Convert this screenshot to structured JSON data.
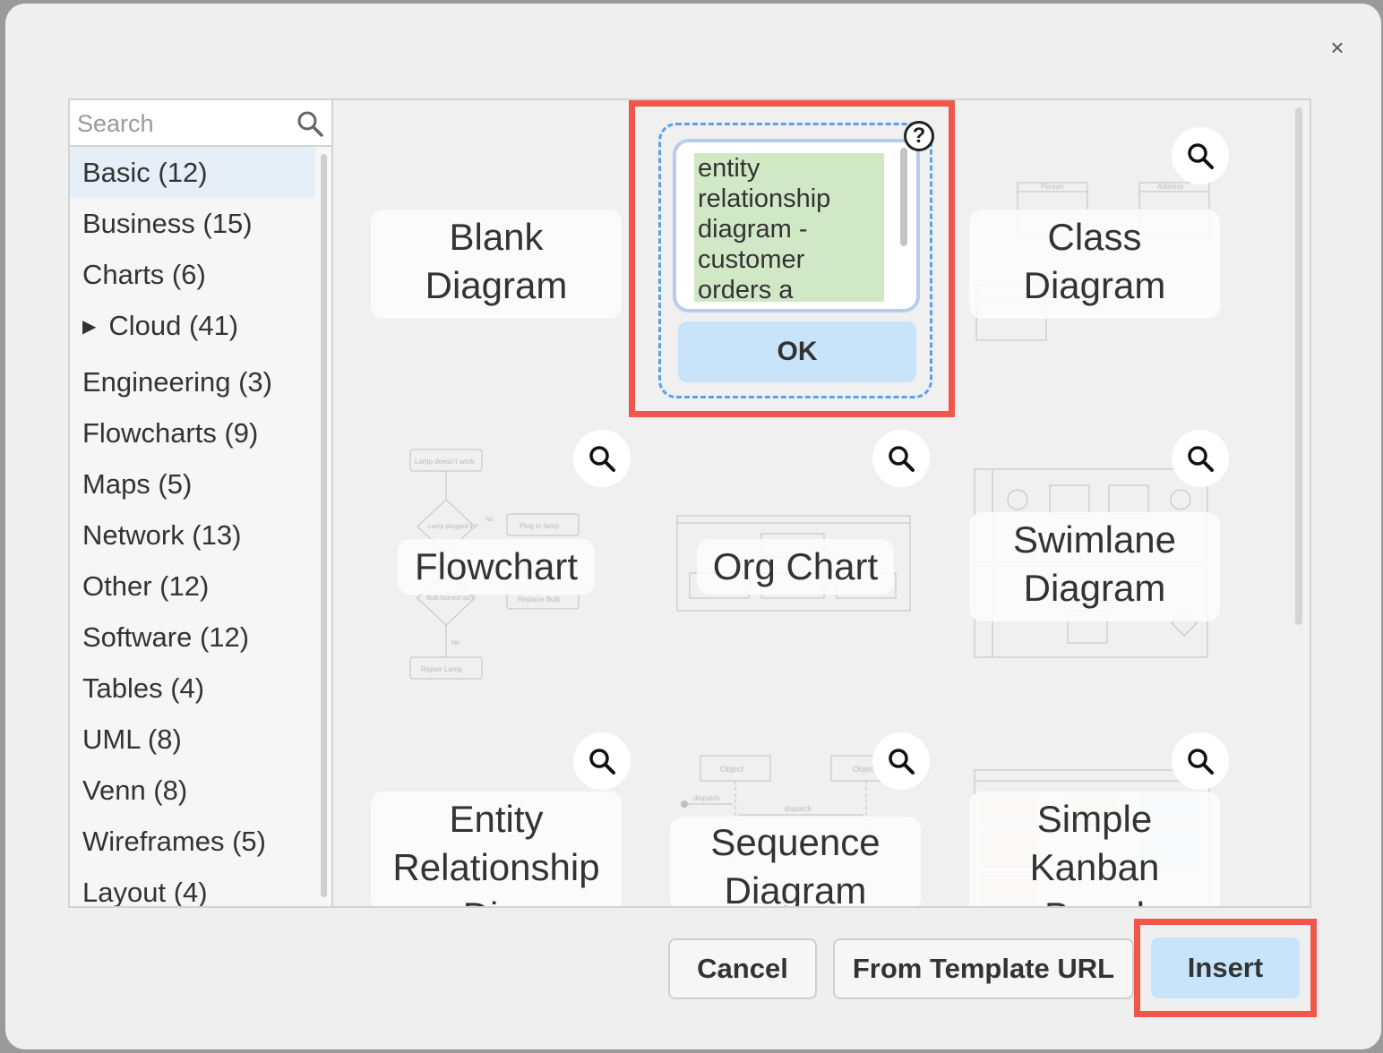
{
  "search": {
    "placeholder": "Search"
  },
  "categories": [
    {
      "label": "Basic (12)"
    },
    {
      "label": "Business (15)"
    },
    {
      "label": "Charts (6)"
    },
    {
      "label": "Cloud (41)",
      "arrow": "▶"
    },
    {
      "label": "Engineering (3)"
    },
    {
      "label": "Flowcharts (9)"
    },
    {
      "label": "Maps (5)"
    },
    {
      "label": "Network (13)"
    },
    {
      "label": "Other (12)"
    },
    {
      "label": "Software (12)"
    },
    {
      "label": "Tables (4)"
    },
    {
      "label": "UML (8)"
    },
    {
      "label": "Venn (8)"
    },
    {
      "label": "Wireframes (5)"
    },
    {
      "label": "Layout (4)"
    }
  ],
  "templates": {
    "blank": {
      "line1": "Blank",
      "line2": "Diagram"
    },
    "er_prompt": {
      "text": [
        "entity",
        "relationship",
        "diagram -",
        "customer",
        "orders a"
      ],
      "ok_label": "OK",
      "help_glyph": "?"
    },
    "class": {
      "line1": "Class",
      "line2": "Diagram"
    },
    "flowchart": {
      "line1": "Flowchart"
    },
    "orgchart": {
      "line1": "Org Chart"
    },
    "swimlane": {
      "line1": "Swimlane",
      "line2": "Diagram"
    },
    "entity": {
      "line1": "Entity",
      "line2": "Relationship",
      "line3": "Di..."
    },
    "sequence": {
      "line1": "Sequence",
      "line2": "Diagram"
    },
    "kanban": {
      "line1": "Simple",
      "line2": "Kanban",
      "line3": "Board"
    }
  },
  "thumb_text": {
    "lamp": "Lamp doesn't work",
    "plugged": "Lamp plugged in?",
    "plug_in": "Plug in lamp",
    "burned": "Bulb burned out?",
    "replace_bulb": "Replace Bulb",
    "repair": "Repair Lamp",
    "no": "No",
    "yes": "Yes",
    "person": "Person",
    "address": "Address",
    "object": "Object",
    "dispatch": "dispatch"
  },
  "buttons": {
    "cancel": "Cancel",
    "from_template_url": "From Template URL",
    "insert": "Insert",
    "close_glyph": "×"
  },
  "colors": {
    "highlight": "#f0574a",
    "selected_bg": "#e6eef7",
    "primary_button": "#c7e4fa",
    "er_text_bg": "#d0e8c6",
    "dashed_border": "#5aa1ea"
  }
}
